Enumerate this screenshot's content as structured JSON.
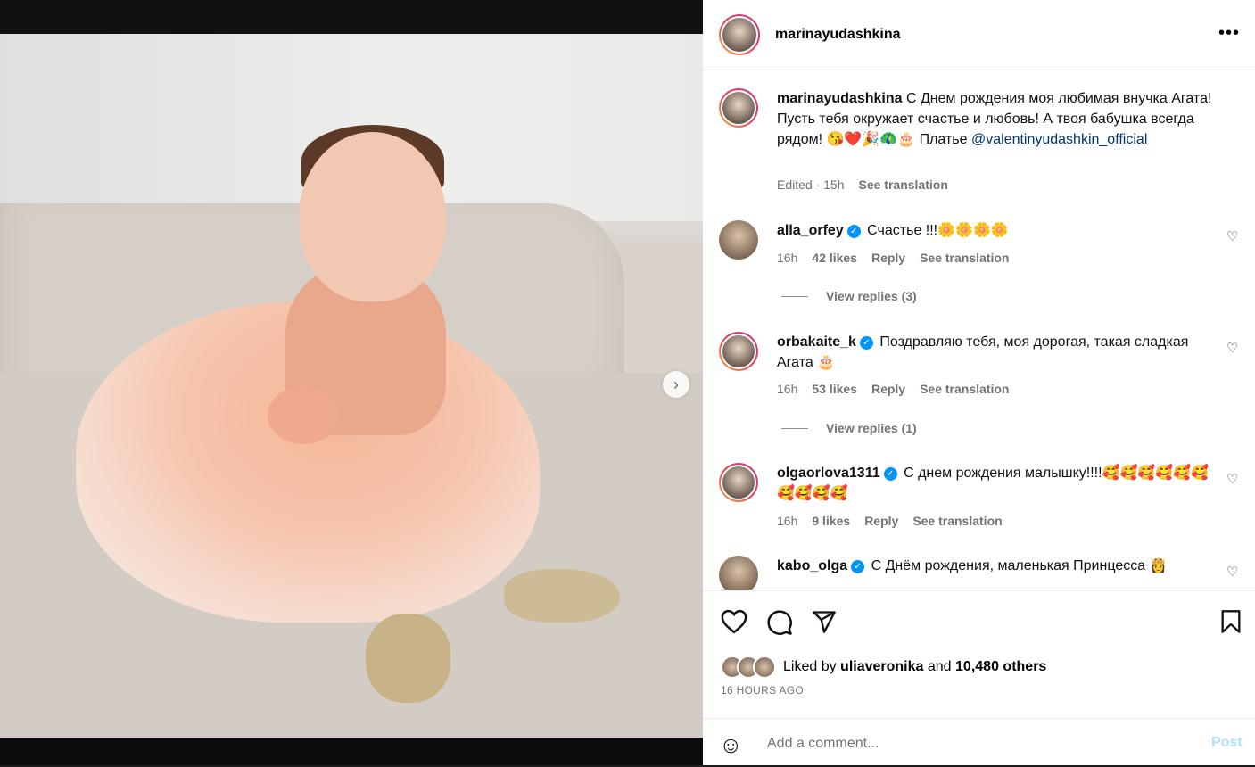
{
  "header": {
    "username": "marinayudashkina",
    "more_icon": "more-horizontal-icon"
  },
  "caption": {
    "username": "marinayudashkina",
    "text": "С Днем рождения моя любимая внучка Агата! Пусть тебя окружает счастье и любовь! А твоя бабушка всегда рядом! 😘❤️🎉🦚🎂 Платье",
    "mention": "@valentinyudashkin_official",
    "edited": "Edited · 15h",
    "see_translation": "See translation"
  },
  "comments": [
    {
      "username": "alla_orfey",
      "verified": true,
      "text": "Счастье !!!🌼🌼🌼🌼",
      "time": "16h",
      "likes": "42 likes",
      "reply": "Reply",
      "translate": "See translation",
      "replies": "View replies (3)"
    },
    {
      "username": "orbakaite_k",
      "verified": true,
      "text": "Поздравляю тебя, моя дорогая, такая сладкая Агата 🎂",
      "time": "16h",
      "likes": "53 likes",
      "reply": "Reply",
      "translate": "See translation",
      "replies": "View replies (1)"
    },
    {
      "username": "olgaorlova1311",
      "verified": true,
      "text": "С днем рождения малышку!!!!🥰🥰🥰🥰🥰🥰🥰🥰🥰🥰",
      "time": "16h",
      "likes": "9 likes",
      "reply": "Reply",
      "translate": "See translation"
    },
    {
      "username": "kabo_olga",
      "verified": true,
      "text": "С Днём рождения, маленькая Принцесса 👸"
    }
  ],
  "actions": {
    "like_icon": "heart-icon",
    "comment_icon": "comment-icon",
    "share_icon": "send-icon",
    "save_icon": "bookmark-icon"
  },
  "likes": {
    "prefix": "Liked by",
    "user": "uliaveronika",
    "and": "and",
    "others": "10,480 others"
  },
  "time_ago": "16 HOURS AGO",
  "add_comment": {
    "placeholder": "Add a comment...",
    "post": "Post"
  },
  "media": {
    "slide_current": 1,
    "slide_total": 2
  }
}
